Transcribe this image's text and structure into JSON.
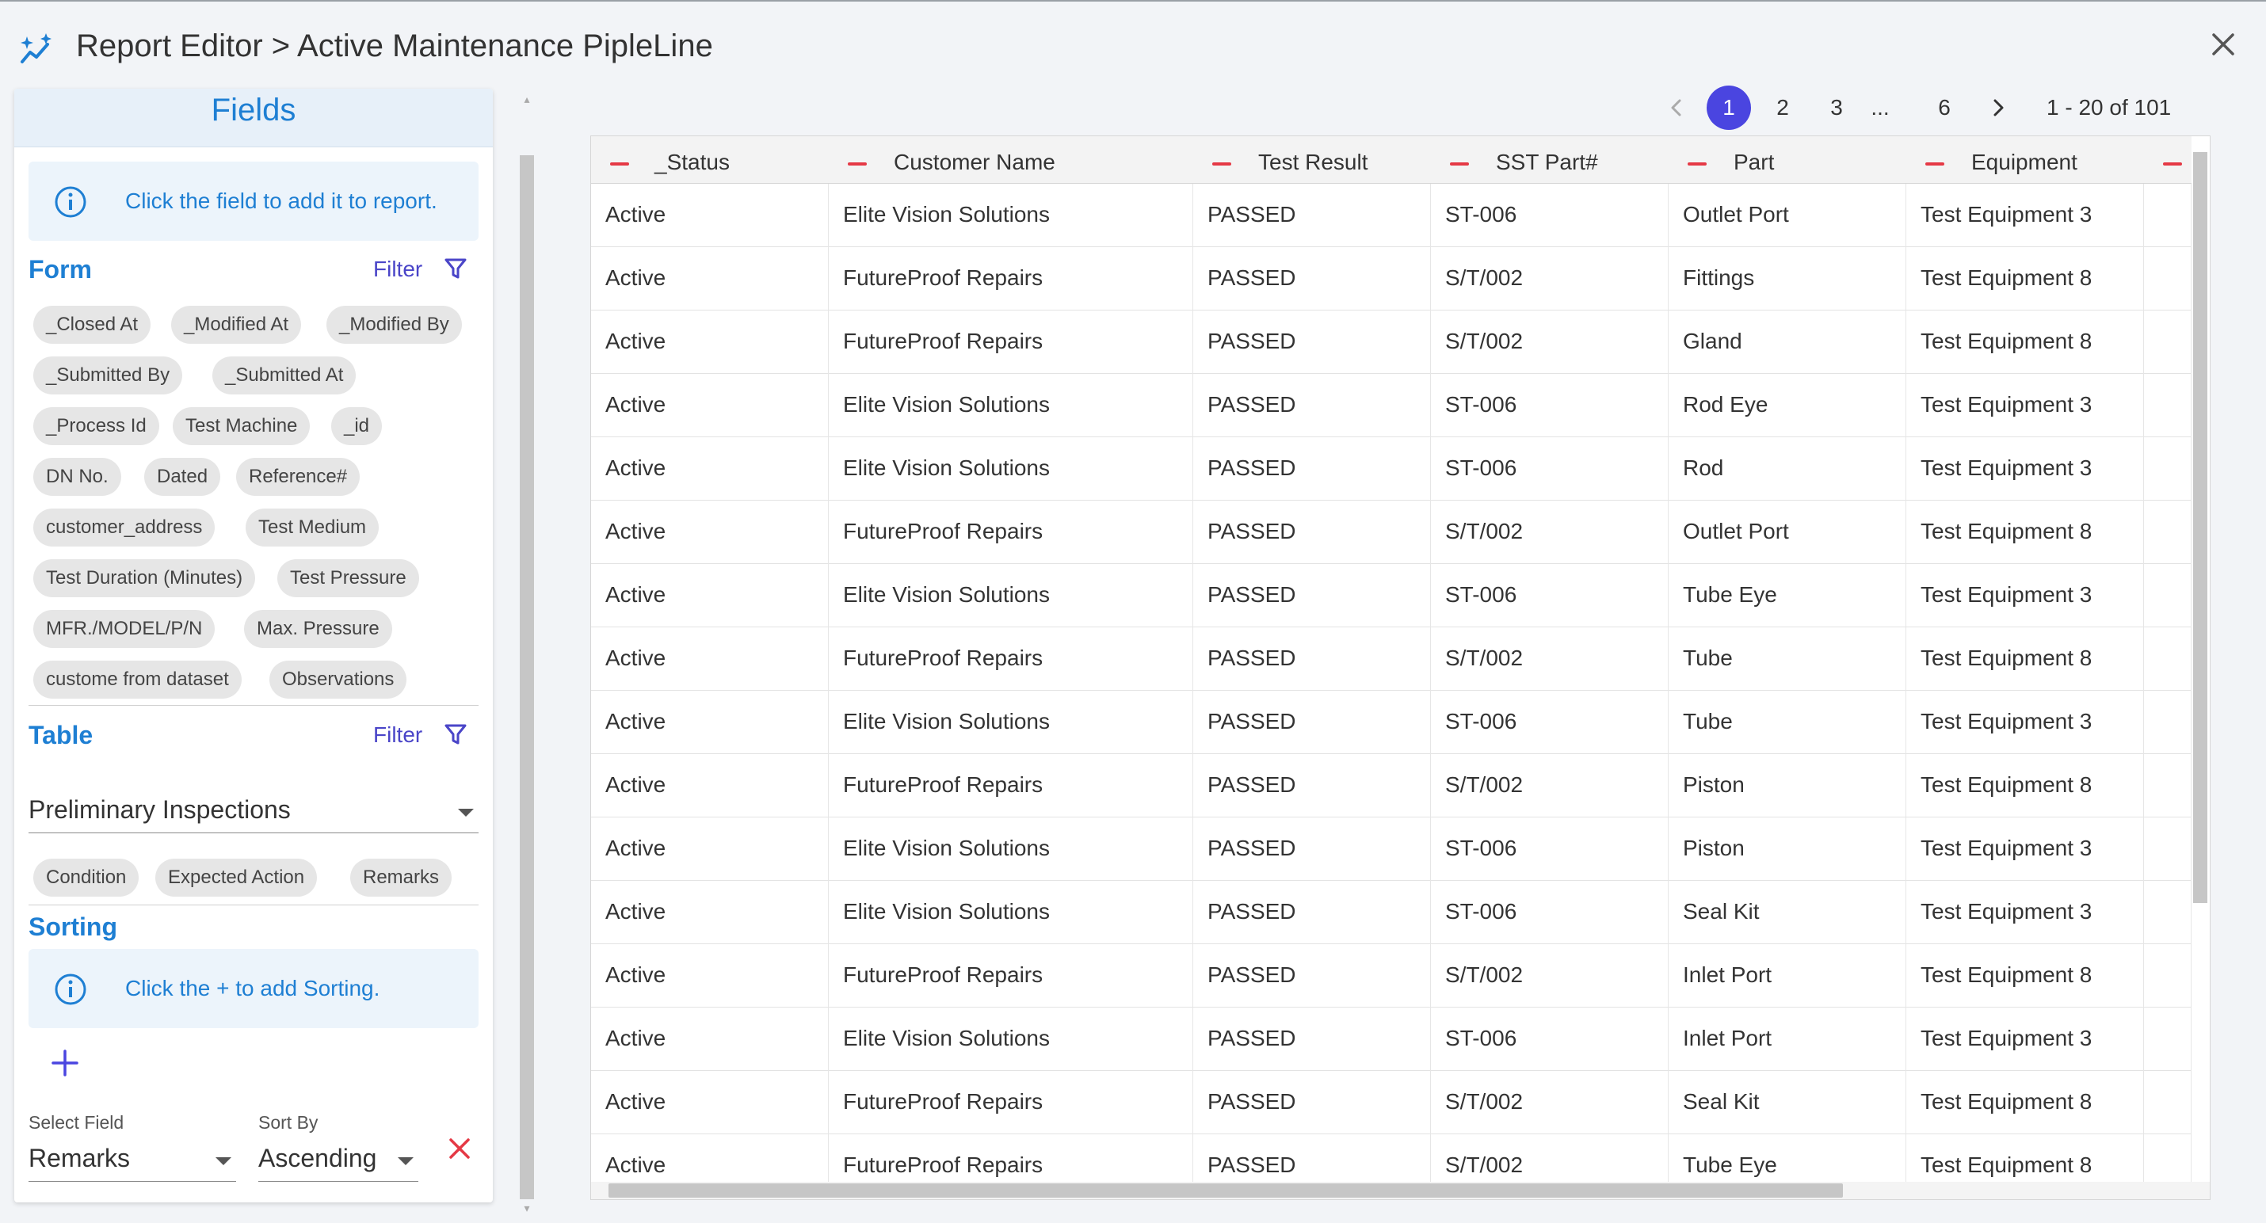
{
  "header": {
    "title": "Report Editor > Active Maintenance PipleLine"
  },
  "fields_panel": {
    "title": "Fields",
    "info_text": "Click the field to add it to report.",
    "form": {
      "title": "Form",
      "filter_label": "Filter",
      "chips": [
        "_Closed At",
        "_Modified At",
        "_Modified By",
        "_Submitted By",
        "_Submitted At",
        "_Process Id",
        "Test Machine",
        "_id",
        "DN No.",
        "Dated",
        "Reference#",
        "customer_address",
        "Test Medium",
        "Test Duration (Minutes)",
        "Test Pressure",
        "MFR./MODEL/P/N",
        "Max. Pressure",
        "custome from dataset",
        "Observations"
      ]
    },
    "table": {
      "title": "Table",
      "filter_label": "Filter",
      "selected": "Preliminary Inspections",
      "chips": [
        "Condition",
        "Expected Action",
        "Remarks"
      ]
    },
    "sorting": {
      "title": "Sorting",
      "info_text": "Click the + to add Sorting.",
      "select_field_label": "Select Field",
      "select_field_value": "Remarks",
      "sort_by_label": "Sort By",
      "sort_by_value": "Ascending"
    }
  },
  "pagination": {
    "pages": [
      "1",
      "2",
      "3",
      "...",
      "6"
    ],
    "active": "1",
    "range": "1 - 20 of 101"
  },
  "grid": {
    "columns": [
      "_Status",
      "Customer Name",
      "Test Result",
      "SST Part#",
      "Part",
      "Equipment"
    ],
    "rows": [
      [
        "Active",
        "Elite Vision Solutions",
        "PASSED",
        "ST-006",
        "Outlet Port",
        "Test Equipment 3"
      ],
      [
        "Active",
        "FutureProof Repairs",
        "PASSED",
        "S/T/002",
        "Fittings",
        "Test Equipment 8"
      ],
      [
        "Active",
        "FutureProof Repairs",
        "PASSED",
        "S/T/002",
        "Gland",
        "Test Equipment 8"
      ],
      [
        "Active",
        "Elite Vision Solutions",
        "PASSED",
        "ST-006",
        "Rod Eye",
        "Test Equipment 3"
      ],
      [
        "Active",
        "Elite Vision Solutions",
        "PASSED",
        "ST-006",
        "Rod",
        "Test Equipment 3"
      ],
      [
        "Active",
        "FutureProof Repairs",
        "PASSED",
        "S/T/002",
        "Outlet Port",
        "Test Equipment 8"
      ],
      [
        "Active",
        "Elite Vision Solutions",
        "PASSED",
        "ST-006",
        "Tube Eye",
        "Test Equipment 3"
      ],
      [
        "Active",
        "FutureProof Repairs",
        "PASSED",
        "S/T/002",
        "Tube",
        "Test Equipment 8"
      ],
      [
        "Active",
        "Elite Vision Solutions",
        "PASSED",
        "ST-006",
        "Tube",
        "Test Equipment 3"
      ],
      [
        "Active",
        "FutureProof Repairs",
        "PASSED",
        "S/T/002",
        "Piston",
        "Test Equipment 8"
      ],
      [
        "Active",
        "Elite Vision Solutions",
        "PASSED",
        "ST-006",
        "Piston",
        "Test Equipment 3"
      ],
      [
        "Active",
        "Elite Vision Solutions",
        "PASSED",
        "ST-006",
        "Seal Kit",
        "Test Equipment 3"
      ],
      [
        "Active",
        "FutureProof Repairs",
        "PASSED",
        "S/T/002",
        "Inlet Port",
        "Test Equipment 8"
      ],
      [
        "Active",
        "Elite Vision Solutions",
        "PASSED",
        "ST-006",
        "Inlet Port",
        "Test Equipment 3"
      ],
      [
        "Active",
        "FutureProof Repairs",
        "PASSED",
        "S/T/002",
        "Seal Kit",
        "Test Equipment 8"
      ],
      [
        "Active",
        "FutureProof Repairs",
        "PASSED",
        "S/T/002",
        "Tube Eye",
        "Test Equipment 8"
      ]
    ]
  },
  "colors": {
    "accent_blue": "#1e7fd3",
    "accent_indigo": "#4a45e0",
    "minus_red": "#e53945"
  },
  "icons": {
    "logo": "sparkle-chart-icon",
    "close": "close-icon",
    "info": "info-icon",
    "filter": "filter-icon",
    "plus": "plus-icon",
    "remove": "remove-x-icon",
    "dropdown": "caret-down-icon",
    "prev": "chevron-left-icon",
    "next": "chevron-right-icon"
  }
}
